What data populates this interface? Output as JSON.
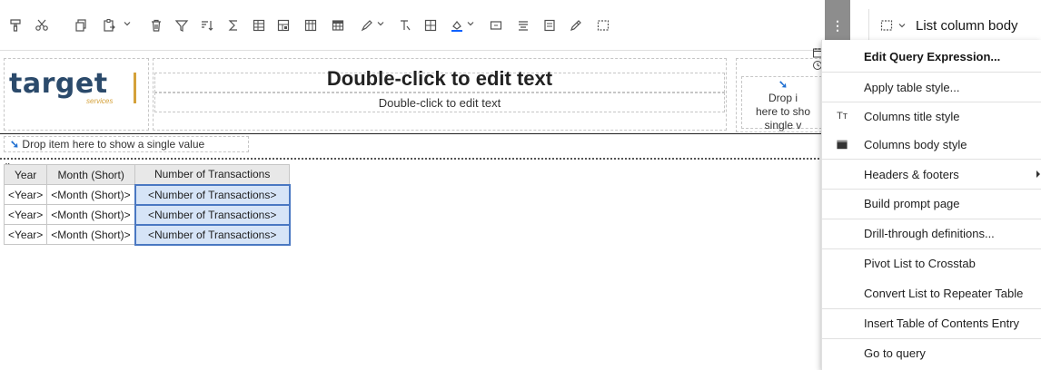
{
  "toolbar": {
    "icons": [
      "paintbrush-icon",
      "scissors-icon",
      "copy-icon",
      "paste-icon",
      "delete-icon",
      "filter-icon",
      "sort-icon",
      "summarize-icon",
      "group-icon",
      "section-icon",
      "borders-icon",
      "table-icon",
      "color-icon",
      "text-style-icon",
      "grid-icon",
      "fill-color-icon",
      "insert-icon",
      "align-icon",
      "layout-icon",
      "edit-icon",
      "select-icon",
      "more-icon"
    ],
    "more_label": "⋮",
    "context_label": "List column body"
  },
  "report": {
    "logo_text": "target",
    "logo_sub": "services",
    "title_main": "Double-click to edit text",
    "title_sub": "Double-click to edit text",
    "drop_right_line1": "Drop i",
    "drop_right_line2": "here to sho",
    "drop_right_line3": "single v",
    "drop_single": "Drop item here to show a single value"
  },
  "list": {
    "columns": [
      "Year",
      "Month (Short)",
      "Number of Transactions"
    ],
    "rows": [
      [
        "<Year>",
        "<Month (Short)>",
        "<Number of Transactions>"
      ],
      [
        "<Year>",
        "<Month (Short)>",
        "<Number of Transactions>"
      ],
      [
        "<Year>",
        "<Month (Short)>",
        "<Number of Transactions>"
      ]
    ]
  },
  "menu": {
    "items": [
      {
        "label": "Edit Query Expression...",
        "icon": ""
      },
      {
        "label": "Apply table style...",
        "icon": ""
      },
      {
        "label": "Columns title style",
        "icon": "Tт"
      },
      {
        "label": "Columns body style",
        "icon": "body-style-icon"
      },
      {
        "label": "Headers & footers",
        "icon": ""
      },
      {
        "label": "Build prompt page",
        "icon": ""
      },
      {
        "label": "Drill-through definitions...",
        "icon": ""
      },
      {
        "label": "Pivot List to Crosstab",
        "icon": ""
      },
      {
        "label": "Convert List to Repeater Table",
        "icon": ""
      },
      {
        "label": "Insert Table of Contents Entry",
        "icon": ""
      },
      {
        "label": "Go to query",
        "icon": ""
      }
    ]
  },
  "colors": {
    "selected_cell": "#d6e4f7",
    "selected_border": "#4a78c2",
    "more_button_bg": "#8d8d8d",
    "logo_blue": "#2b4a6b",
    "logo_gold": "#d4a13a"
  }
}
